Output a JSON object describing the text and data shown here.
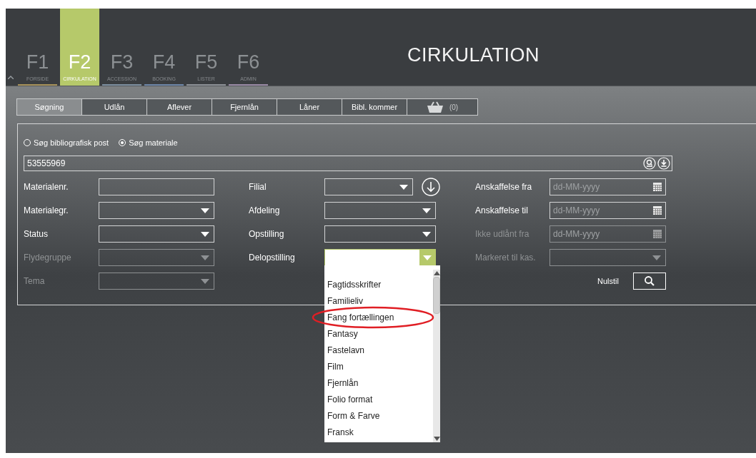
{
  "nav_tabs": [
    {
      "key": "F1",
      "label": "FORSIDE",
      "selected": false,
      "color": "#a8925a"
    },
    {
      "key": "F2",
      "label": "CIRKULATION",
      "selected": true,
      "color": "#b6c96a"
    },
    {
      "key": "F3",
      "label": "ACCESSION",
      "selected": false,
      "color": "#7d8fa0"
    },
    {
      "key": "F4",
      "label": "BOOKING",
      "selected": false,
      "color": "#6d86a8"
    },
    {
      "key": "F5",
      "label": "LISTER",
      "selected": false,
      "color": "#8d9196"
    },
    {
      "key": "F6",
      "label": "ADMIN",
      "selected": false,
      "color": "#9a8aa6"
    }
  ],
  "title": "CIRKULATION",
  "sub_tabs": [
    {
      "kind": "text",
      "label": "Søgning",
      "selected": true
    },
    {
      "kind": "text",
      "label": "Udlån",
      "selected": false
    },
    {
      "kind": "text",
      "label": "Aflever",
      "selected": false
    },
    {
      "kind": "text",
      "label": "Fjernlån",
      "selected": false
    },
    {
      "kind": "text",
      "label": "Låner",
      "selected": false
    },
    {
      "kind": "text",
      "label": "Bibl. kommer",
      "selected": false
    },
    {
      "kind": "basket",
      "label": "(0)",
      "selected": false
    }
  ],
  "search_mode": [
    {
      "label": "Søg bibliografisk post",
      "selected": false
    },
    {
      "label": "Søg materiale",
      "selected": true
    }
  ],
  "search_field": {
    "value": "53555969"
  },
  "left_fields": [
    {
      "label": "Materialenr.",
      "kind": "text",
      "disabled": false
    },
    {
      "label": "Materialegr.",
      "kind": "select",
      "disabled": false
    },
    {
      "label": "Status",
      "kind": "select",
      "disabled": false
    },
    {
      "label": "Flydegruppe",
      "kind": "select",
      "disabled": true
    },
    {
      "label": "Tema",
      "kind": "select",
      "disabled": true
    }
  ],
  "middle_fields": [
    {
      "label": "Filial",
      "open": false,
      "download": true
    },
    {
      "label": "Afdeling",
      "open": false
    },
    {
      "label": "Opstilling",
      "open": false
    },
    {
      "label": "Delopstilling",
      "open": true
    }
  ],
  "right_fields": [
    {
      "label": "Anskaffelse fra",
      "kind": "date",
      "placeholder": "dd-MM-yyyy",
      "disabled": false
    },
    {
      "label": "Anskaffelse til",
      "kind": "date",
      "placeholder": "dd-MM-yyyy",
      "disabled": false
    },
    {
      "label": "Ikke udlånt fra",
      "kind": "date",
      "placeholder": "dd-MM-yyyy",
      "disabled": true
    },
    {
      "label": "Markeret til kas.",
      "kind": "select",
      "disabled": true
    }
  ],
  "reset_button": {
    "label": "Nulstil"
  },
  "dropdown": {
    "items": [
      {
        "label": "Fagtidsskrifter",
        "highlighted": false
      },
      {
        "label": "Familieliv",
        "highlighted": false
      },
      {
        "label": "Fang fortællingen",
        "highlighted": true
      },
      {
        "label": "Fantasy",
        "highlighted": false
      },
      {
        "label": "Fastelavn",
        "highlighted": false
      },
      {
        "label": "Film",
        "highlighted": false
      },
      {
        "label": "Fjernlån",
        "highlighted": false
      },
      {
        "label": "Folio format",
        "highlighted": false
      },
      {
        "label": "Form & Farve",
        "highlighted": false
      },
      {
        "label": "Fransk",
        "highlighted": false
      }
    ]
  }
}
